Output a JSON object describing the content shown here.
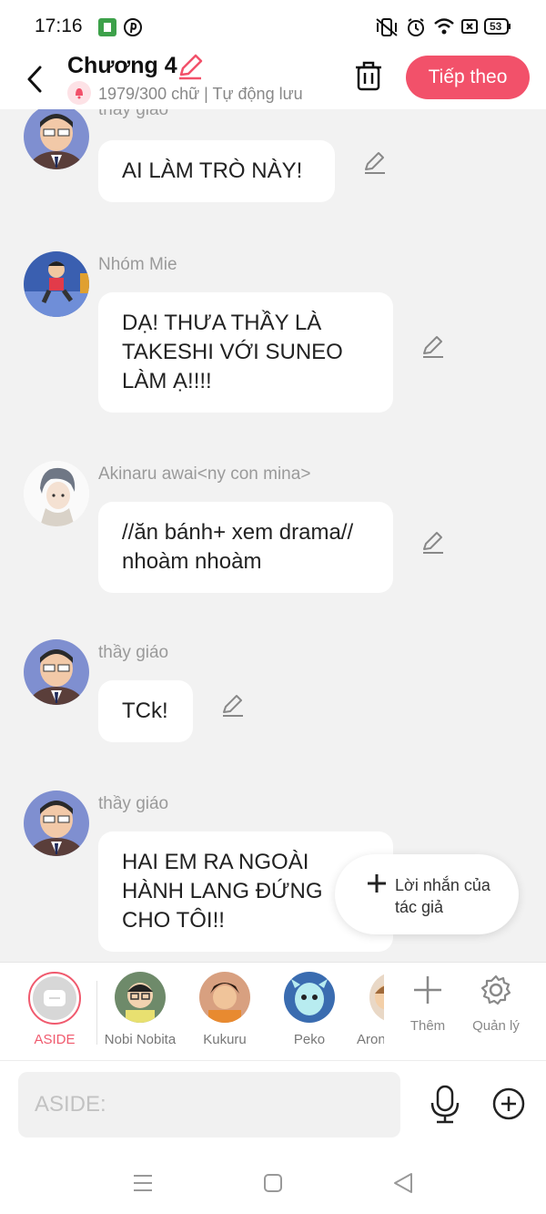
{
  "status_bar": {
    "time": "17:16",
    "battery": "53"
  },
  "header": {
    "title": "Chương 4",
    "subtitle": "1979/300 chữ | Tự động lưu",
    "next_label": "Tiếp theo"
  },
  "messages": [
    {
      "sender": "thầy giáo",
      "text": "AI LÀM TRÒ NÀY!",
      "avatar": "teacher"
    },
    {
      "sender": "Nhóm Mie",
      "text": "DẠ! THƯA THẦY LÀ TAKESHI VỚI SUNEO LÀM Ạ!!!!",
      "avatar": "group"
    },
    {
      "sender": "Akinaru awai<ny con mina>",
      "text": "//ăn bánh+ xem drama// nhoàm nhoàm",
      "avatar": "akinaru"
    },
    {
      "sender": "thầy giáo",
      "text": "TCk!",
      "avatar": "teacher"
    },
    {
      "sender": "thầy giáo",
      "text": "HAI EM RA NGOÀI HÀNH LANG ĐỨNG CHO TÔI!!",
      "avatar": "teacher"
    }
  ],
  "author_note": {
    "label": "Lời nhắn của tác giả"
  },
  "characters": [
    {
      "name": "ASIDE",
      "selected": true
    },
    {
      "name": "Nobi Nobita"
    },
    {
      "name": "Kukuru"
    },
    {
      "name": "Peko"
    },
    {
      "name": "Aron"
    }
  ],
  "tools": {
    "add_label": "Thêm",
    "manage_label": "Quản lý"
  },
  "input": {
    "placeholder": "ASIDE:"
  },
  "colors": {
    "accent": "#f2516a",
    "background": "#f2f2f2"
  }
}
